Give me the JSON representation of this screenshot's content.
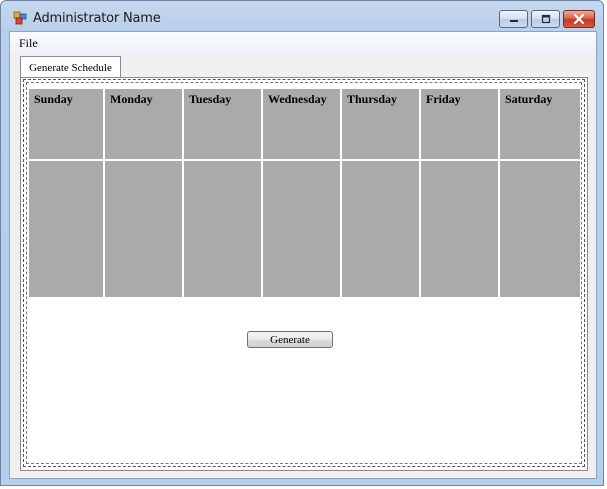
{
  "window": {
    "title": "Administrator Name",
    "controls": {
      "minimize": "minimize",
      "maximize": "maximize",
      "close": "close"
    }
  },
  "menu": {
    "items": [
      {
        "label": "File"
      }
    ]
  },
  "tabs": [
    {
      "label": "Generate Schedule",
      "selected": true
    }
  ],
  "calendar": {
    "days": [
      "Sunday",
      "Monday",
      "Tuesday",
      "Wednesday",
      "Thursday",
      "Friday",
      "Saturday"
    ],
    "cell_color": "#aaaaaa"
  },
  "actions": {
    "generate_label": "Generate"
  },
  "colors": {
    "close_button": "#c2381f",
    "title_bar": "#b9cfe9",
    "grid_lines": "#ffffff"
  }
}
